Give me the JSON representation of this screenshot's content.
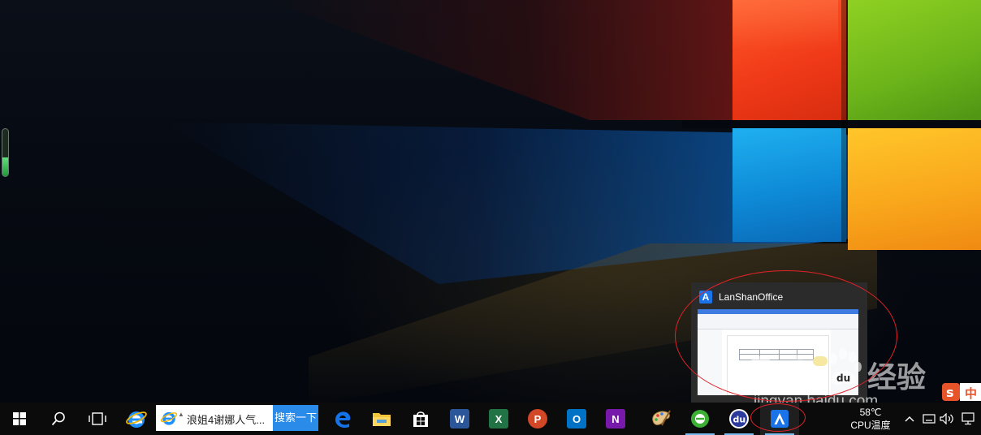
{
  "desktop": {
    "cpu_gauge_level": 0.4
  },
  "thumbnail": {
    "app_title": "LanShanOffice",
    "app_glyph": "A"
  },
  "watermark": {
    "brand_latin": "Bai",
    "brand_cn": "经验",
    "url": "jingyan.baidu.com"
  },
  "taskbar": {
    "search": {
      "text": "浪姐4谢娜人气...",
      "button_label": "搜索一下"
    },
    "apps": [
      {
        "name": "ie",
        "label": "e",
        "color": "#1e90ff"
      },
      {
        "name": "edge",
        "label": "e",
        "color": "#1473e6"
      },
      {
        "name": "file-explorer",
        "label": "",
        "color": "#f3c53d"
      },
      {
        "name": "store",
        "label": "",
        "color": "#ffffff"
      },
      {
        "name": "word",
        "label": "W",
        "color": "#2b579a"
      },
      {
        "name": "excel",
        "label": "X",
        "color": "#217346"
      },
      {
        "name": "powerpoint",
        "label": "P",
        "color": "#d24726"
      },
      {
        "name": "outlook",
        "label": "O",
        "color": "#0072c6"
      },
      {
        "name": "onenote",
        "label": "N",
        "color": "#7719aa"
      },
      {
        "name": "paint",
        "label": "",
        "color": "#d9a44a"
      },
      {
        "name": "360-browser",
        "label": "e",
        "color": "#3cb034"
      },
      {
        "name": "baidu-netdisk",
        "label": "du",
        "color": "#2b3b9e"
      },
      {
        "name": "lanshanoffice",
        "label": "A",
        "color": "#1a73e8"
      }
    ],
    "tray": {
      "cpu_temp": "58℃",
      "cpu_label": "CPU温度",
      "ime_label": "中"
    }
  },
  "colors": {
    "taskbar_bg": "#0b0b0c",
    "accent": "#76b9ed",
    "annotation": "#e0232a"
  }
}
